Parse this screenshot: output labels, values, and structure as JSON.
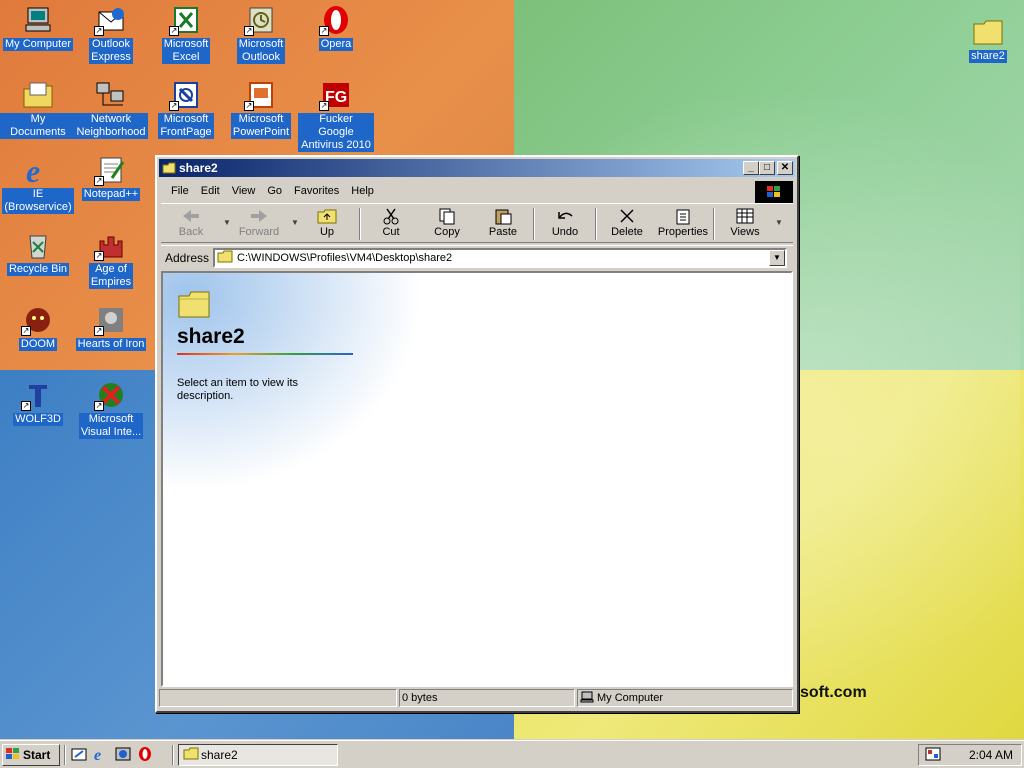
{
  "desktop": {
    "icons": [
      {
        "label": "My Computer"
      },
      {
        "label": "Outlook\nExpress"
      },
      {
        "label": "Microsoft\nExcel"
      },
      {
        "label": "Microsoft\nOutlook"
      },
      {
        "label": "Opera"
      },
      {
        "label": "My Documents"
      },
      {
        "label": "Network\nNeighborhood"
      },
      {
        "label": "Microsoft\nFrontPage"
      },
      {
        "label": "Microsoft\nPowerPoint"
      },
      {
        "label": "Fucker Google\nAntivirus 2010"
      },
      {
        "label": "IE\n(Browservice)"
      },
      {
        "label": "Notepad++"
      },
      {
        "label": "Recycle Bin"
      },
      {
        "label": "Age of\nEmpires"
      },
      {
        "label": "DOOM"
      },
      {
        "label": "Hearts of Iron"
      },
      {
        "label": "WOLF3D"
      },
      {
        "label": "Microsoft\nVisual Inte..."
      },
      {
        "label": "share2"
      }
    ],
    "wallpaper_text": "soft.com"
  },
  "window": {
    "title": "share2",
    "menu": [
      "File",
      "Edit",
      "View",
      "Go",
      "Favorites",
      "Help"
    ],
    "toolbar": {
      "back": "Back",
      "forward": "Forward",
      "up": "Up",
      "cut": "Cut",
      "copy": "Copy",
      "paste": "Paste",
      "undo": "Undo",
      "delete": "Delete",
      "properties": "Properties",
      "views": "Views"
    },
    "address_label": "Address",
    "address_value": "C:\\WINDOWS\\Profiles\\VM4\\Desktop\\share2",
    "content": {
      "folder_name": "share2",
      "description": "Select an item to view its description."
    },
    "status": {
      "size": "0 bytes",
      "zone": "My Computer"
    }
  },
  "taskbar": {
    "start_label": "Start",
    "task_label": "share2",
    "clock": "2:04 AM"
  },
  "colors": {
    "selection_blue": "#1e66c8",
    "title_active": "#0a246a",
    "face": "#d4d0c8"
  }
}
